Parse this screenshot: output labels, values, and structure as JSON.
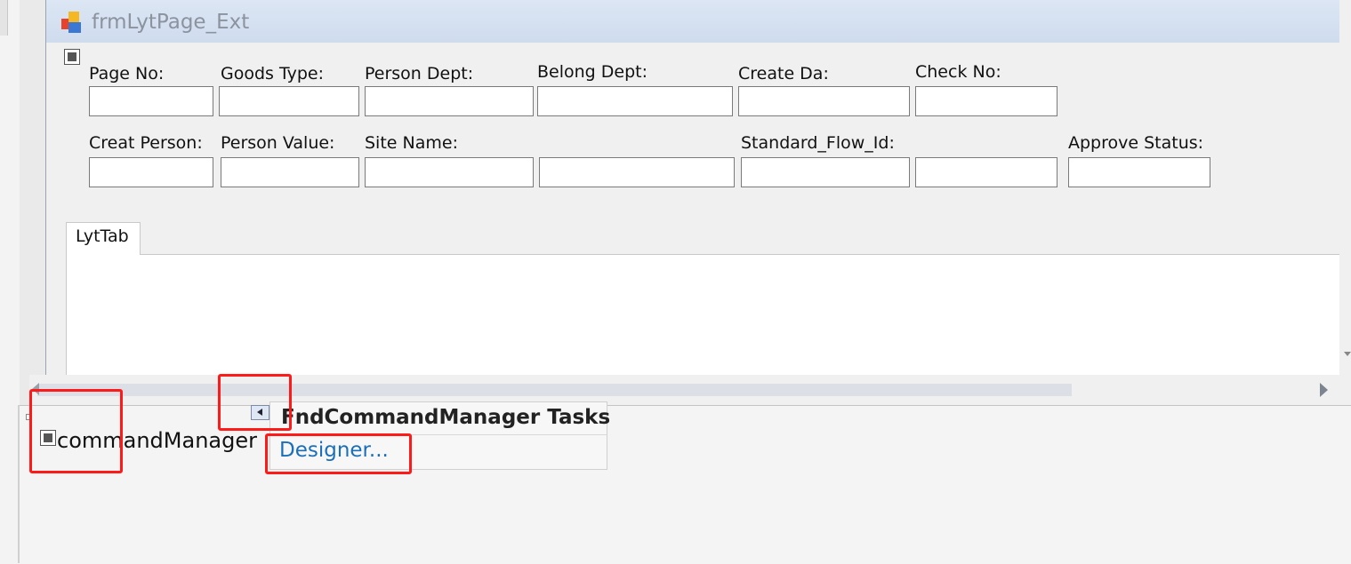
{
  "form": {
    "title": "frmLytPage_Ext"
  },
  "fields": {
    "page_no": "Page No:",
    "goods_type": "Goods Type:",
    "person_dept": "Person Dept:",
    "belong_dept": "Belong Dept:",
    "create_da": "Create Da:",
    "check_no": "Check No:",
    "creat_person": "Creat Person:",
    "person_value": "Person Value:",
    "site_name": "Site Name:",
    "standard_flow_id": "Standard_Flow_Id:",
    "approve_status": "Approve Status:"
  },
  "tabs": [
    "LytTab"
  ],
  "tray": {
    "component": "commandManager"
  },
  "tasks": {
    "title": "FndCommandManager Tasks",
    "designer_link": "Designer..."
  },
  "colors": {
    "highlight": "#ff1a1a",
    "link": "#1b6fb8",
    "title_bar": "#dce6f4"
  },
  "icons": [
    "form-icon",
    "selection-glyph-icon",
    "smart-tag-arrow-icon"
  ]
}
